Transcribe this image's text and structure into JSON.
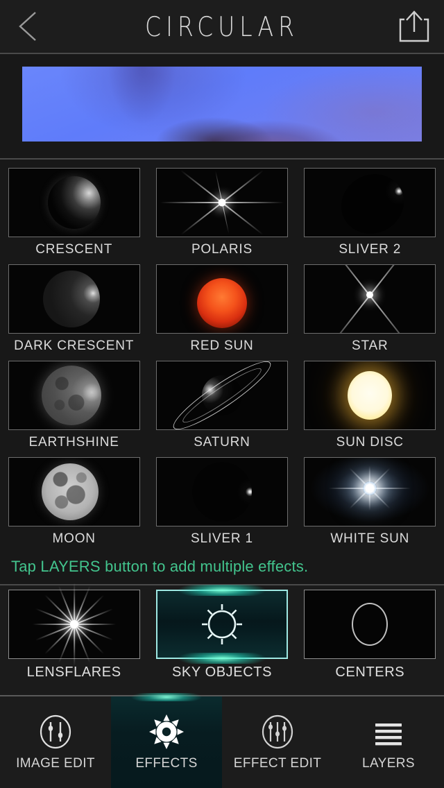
{
  "header": {
    "title": "CIRCULAR",
    "back_icon": "chevron-left-icon",
    "share_icon": "share-upload-icon"
  },
  "preview": {
    "name": "effect-preview-image",
    "description": "blue purple blurred sky photo"
  },
  "effects": {
    "items": [
      {
        "label": "CRESCENT",
        "art": "crescent-moon"
      },
      {
        "label": "POLARIS",
        "art": "six-point-star-flare"
      },
      {
        "label": "SLIVER 2",
        "art": "thin-crescent-tilted"
      },
      {
        "label": "DARK CRESCENT",
        "art": "dark-crescent-moon"
      },
      {
        "label": "RED SUN",
        "art": "red-sun-orb"
      },
      {
        "label": "STAR",
        "art": "x-cross-star"
      },
      {
        "label": "EARTHSHINE",
        "art": "earthshine-moon"
      },
      {
        "label": "SATURN",
        "art": "ringed-planet"
      },
      {
        "label": "SUN DISC",
        "art": "bright-sun-disc"
      },
      {
        "label": "MOON",
        "art": "full-moon"
      },
      {
        "label": "SLIVER 1",
        "art": "thin-crescent-arc"
      },
      {
        "label": "WHITE SUN",
        "art": "white-sun-burst"
      }
    ]
  },
  "hint": {
    "text": "Tap LAYERS button to add multiple effects.",
    "color": "#43c58e"
  },
  "categories": {
    "items": [
      {
        "label": "LENSFLARES",
        "icon": "starburst-icon",
        "selected": false
      },
      {
        "label": "SKY OBJECTS",
        "icon": "sun-outline-icon",
        "selected": true
      },
      {
        "label": "CENTERS",
        "icon": "circle-icon",
        "selected": false
      }
    ],
    "selected": "SKY OBJECTS",
    "accent_color": "#9fe9e4"
  },
  "tabbar": {
    "items": [
      {
        "label": "IMAGE EDIT",
        "icon": "sliders-circle-icon",
        "active": false
      },
      {
        "label": "EFFECTS",
        "icon": "sun-filled-icon",
        "active": true
      },
      {
        "label": "EFFECT EDIT",
        "icon": "sliders-three-circle-icon",
        "active": false
      },
      {
        "label": "LAYERS",
        "icon": "hamburger-lines-icon",
        "active": false
      }
    ],
    "active": "EFFECTS"
  }
}
